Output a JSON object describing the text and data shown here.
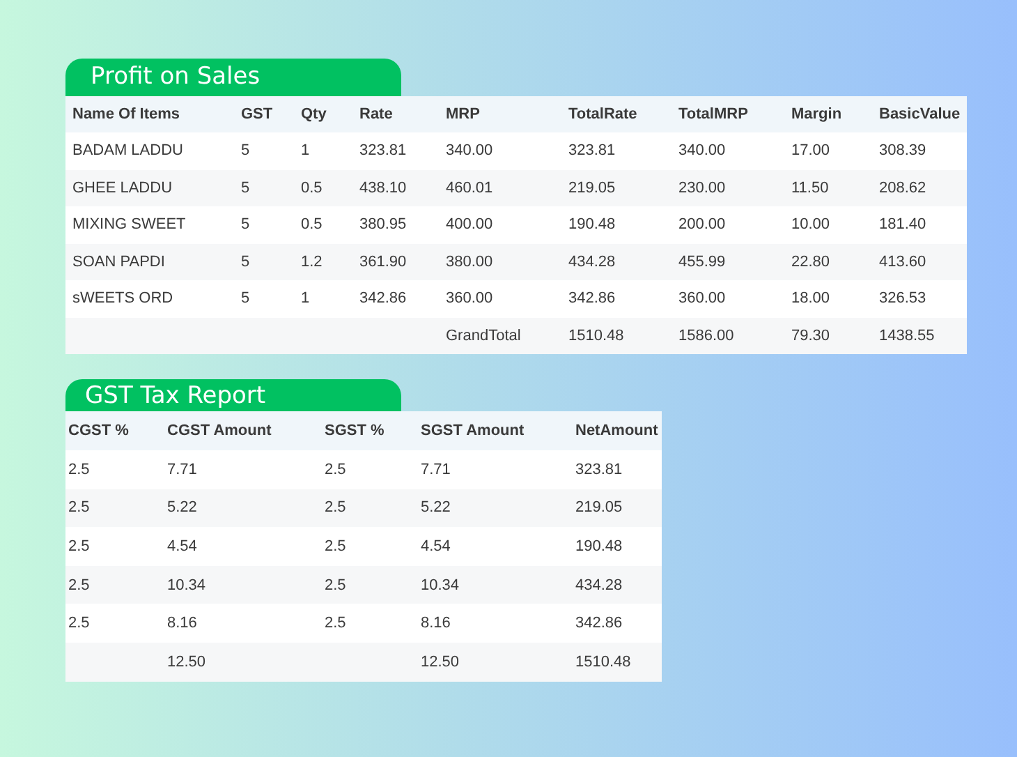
{
  "profit_on_sales": {
    "title": "Profit on Sales",
    "columns": [
      "Name Of Items",
      "GST",
      "Qty",
      "Rate",
      "MRP",
      "TotalRate",
      "TotalMRP",
      "Margin",
      "BasicValue"
    ],
    "rows": [
      [
        "BADAM LADDU",
        "5",
        "1",
        "323.81",
        "340.00",
        "323.81",
        "340.00",
        "17.00",
        "308.39"
      ],
      [
        "GHEE LADDU",
        "5",
        "0.5",
        "438.10",
        "460.01",
        "219.05",
        "230.00",
        "11.50",
        "208.62"
      ],
      [
        "MIXING SWEET",
        "5",
        "0.5",
        "380.95",
        "400.00",
        "190.48",
        "200.00",
        "10.00",
        "181.40"
      ],
      [
        "SOAN PAPDI",
        "5",
        "1.2",
        "361.90",
        "380.00",
        "434.28",
        "455.99",
        "22.80",
        "413.60"
      ],
      [
        "sWEETS ORD",
        "5",
        "1",
        "342.86",
        "360.00",
        "342.86",
        "360.00",
        "18.00",
        "326.53"
      ],
      [
        null,
        null,
        null,
        null,
        "GrandTotal",
        "1510.48",
        "1586.00",
        "79.30",
        "1438.55"
      ]
    ]
  },
  "gst_tax_report": {
    "title": "GST Tax Report",
    "columns": [
      "CGST %",
      "CGST Amount",
      "SGST %",
      "SGST Amount",
      "NetAmount"
    ],
    "rows": [
      [
        "2.5",
        "7.71",
        "2.5",
        "7.71",
        "323.81"
      ],
      [
        "2.5",
        "5.22",
        "2.5",
        "5.22",
        "219.05"
      ],
      [
        "2.5",
        "4.54",
        "2.5",
        "4.54",
        "190.48"
      ],
      [
        "2.5",
        "10.34",
        "2.5",
        "10.34",
        "434.28"
      ],
      [
        "2.5",
        "8.16",
        "2.5",
        "8.16",
        "342.86"
      ],
      [
        null,
        "12.50",
        null,
        "12.50",
        "1510.48"
      ]
    ]
  }
}
